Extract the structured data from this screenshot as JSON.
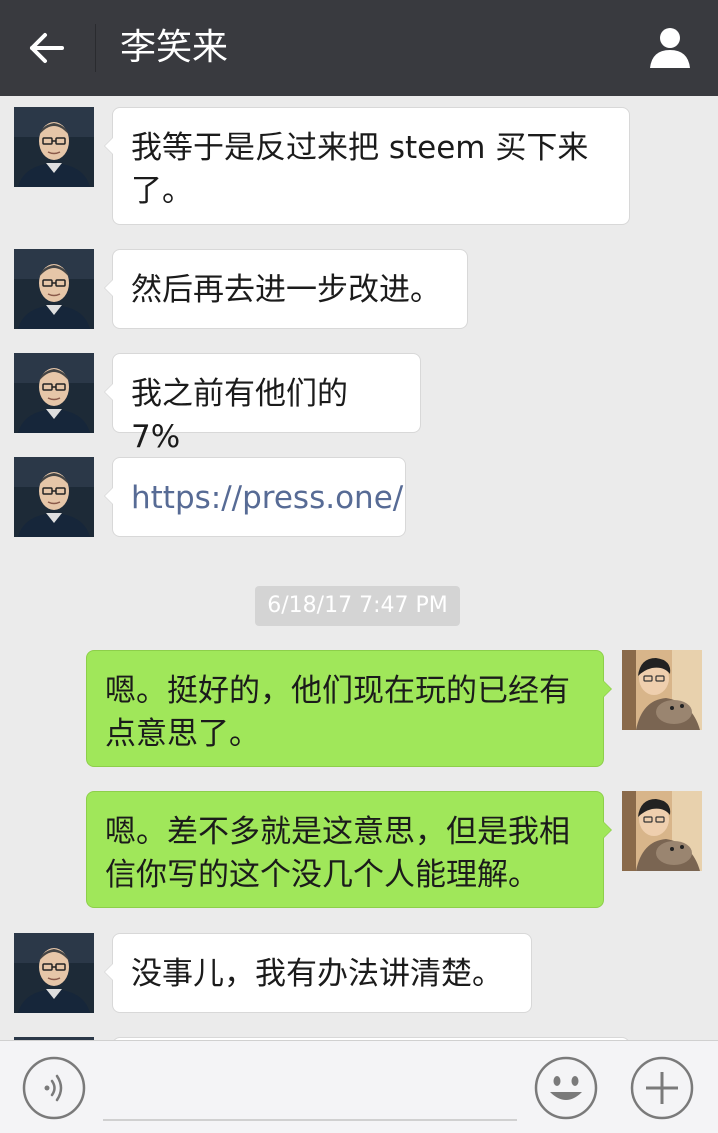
{
  "header": {
    "title": "李笑来",
    "back_icon": "arrow-left-icon",
    "profile_icon": "person-icon"
  },
  "messages": [
    {
      "side": "left",
      "text": "我等于是反过来把 steem 买下来了。"
    },
    {
      "side": "left",
      "text": "然后再去进一步改进。"
    },
    {
      "side": "left",
      "text": "我之前有他们的 7%"
    },
    {
      "side": "left",
      "text": "https://press.one/",
      "is_link": true
    },
    {
      "side": "right",
      "text": "嗯。挺好的，他们现在玩的已经有点意思了。"
    },
    {
      "side": "right",
      "text": "嗯。差不多就是这意思，但是我相信你写的这个没几个人能理解。"
    },
    {
      "side": "left",
      "text": "没事儿，我有办法讲清楚。"
    }
  ],
  "timestamp": "6/18/17 7:47 PM",
  "footer": {
    "voice_icon": "voice-icon",
    "emoji_icon": "emoji-icon",
    "plus_icon": "plus-icon",
    "input_value": ""
  },
  "colors": {
    "header_bg": "#393a3f",
    "chat_bg": "#ebebeb",
    "sent_bubble": "#a0e75a",
    "received_bubble": "#ffffff",
    "link": "#576b95"
  }
}
